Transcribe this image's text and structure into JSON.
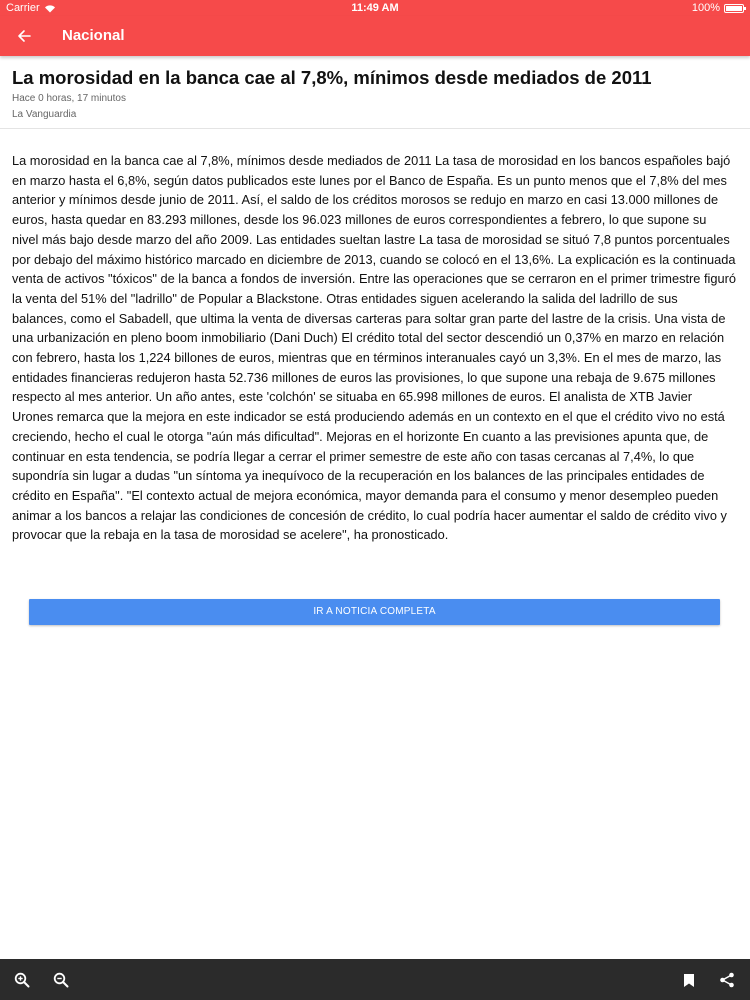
{
  "status_bar": {
    "carrier": "Carrier",
    "time": "11:49 AM",
    "battery": "100%"
  },
  "app_bar": {
    "title": "Nacional",
    "back_icon": "arrow-left-icon",
    "color": "#f64a4a"
  },
  "article": {
    "headline": "La morosidad en la banca cae al 7,8%, mínimos desde mediados de 2011",
    "time_ago": "Hace 0 horas, 17 minutos",
    "source": "La Vanguardia",
    "body": "La morosidad en la banca cae al 7,8%, mínimos desde mediados de 2011 La tasa de morosidad en los bancos españoles bajó en marzo hasta el 6,8%, según datos publicados este lunes por el Banco de España. Es un punto menos que el 7,8% del mes anterior y mínimos desde junio de 2011. Así, el saldo de los créditos morosos se redujo en marzo en casi 13.000 millones de euros, hasta quedar en 83.293 millones, desde los 96.023 millones de euros correspondientes a febrero, lo que supone su nivel más bajo desde marzo del año 2009. Las entidades sueltan lastre La tasa de morosidad se situó 7,8 puntos porcentuales por debajo del máximo histórico marcado en diciembre de 2013, cuando se colocó en el 13,6%. La explicación es la continuada venta de activos \"tóxicos\" de la banca a fondos de inversión. Entre las operaciones que se cerraron en el primer trimestre figuró la venta del 51% del \"ladrillo\" de Popular a Blackstone. Otras entidades siguen acelerando la salida del ladrillo de sus balances, como el Sabadell, que ultima la venta de diversas carteras para soltar gran parte del lastre de la crisis. Una vista de una urbanización en pleno boom inmobiliario (Dani Duch) El crédito total del sector descendió un 0,37% en marzo en relación con febrero, hasta los 1,224 billones de euros, mientras que en términos interanuales cayó un 3,3%. En el mes de marzo, las entidades financieras redujeron hasta 52.736 millones de euros las provisiones, lo que supone una rebaja de 9.675 millones respecto al mes anterior. Un año antes, este 'colchón' se situaba en 65.998 millones de euros. El analista de XTB Javier Urones remarca que la mejora en este indicador se está produciendo además en un contexto en el que el crédito vivo no está creciendo, hecho el cual le otorga \"aún más dificultad\". Mejoras en el horizonte En cuanto a las previsiones apunta que, de continuar en esta tendencia, se podría llegar a cerrar el primer semestre de este año con tasas cercanas al 7,4%, lo que supondría sin lugar a dudas \"un síntoma ya inequívoco de la recuperación en los balances de las principales entidades de crédito en España\". \"El contexto actual de mejora económica, mayor demanda para el consumo y menor desempleo pueden animar a los bancos a relajar las condiciones de concesión de crédito, lo cual podría hacer aumentar el saldo de crédito vivo y provocar que la rebaja en la tasa de morosidad se acelere\", ha pronosticado."
  },
  "cta_button": {
    "label": "IR A NOTICIA COMPLETA",
    "color": "#4a8df0"
  },
  "bottom_bar": {
    "left_icons": [
      "zoom-in-icon",
      "zoom-out-icon"
    ],
    "right_icons": [
      "bookmark-icon",
      "share-icon"
    ]
  }
}
